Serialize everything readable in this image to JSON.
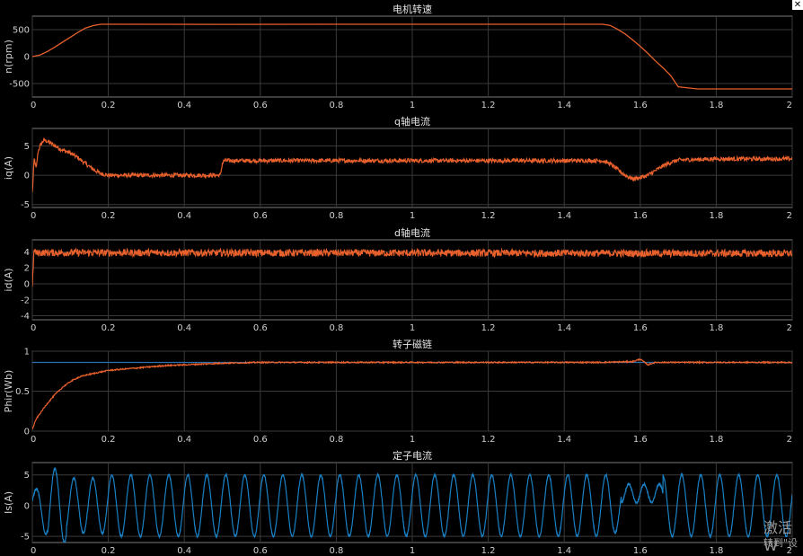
{
  "window": {
    "close_glyph": "✕"
  },
  "watermark": {
    "line1": "激活 W",
    "line2": "转到\"设"
  },
  "colors": {
    "orange": "#e8602c",
    "blue": "#1a80c4",
    "ref_blue": "#2a6fb0"
  },
  "chart_data": [
    {
      "type": "line",
      "title": "电机转速",
      "ylabel": "n(rpm)",
      "xlim": [
        0,
        2
      ],
      "ylim": [
        -750,
        750
      ],
      "xticks": [
        "0",
        "0.2",
        "0.4",
        "0.6",
        "0.8",
        "1",
        "1.2",
        "1.4",
        "1.6",
        "1.8",
        "2"
      ],
      "yticks": [
        "500",
        "0",
        "-500"
      ],
      "series": [
        {
          "color": "#e8602c",
          "x": [
            0,
            0.02,
            0.04,
            0.06,
            0.08,
            0.1,
            0.12,
            0.14,
            0.16,
            0.18,
            0.2,
            0.5,
            1.0,
            1.5,
            1.52,
            1.54,
            1.56,
            1.58,
            1.6,
            1.62,
            1.64,
            1.66,
            1.68,
            1.7,
            1.75,
            2.0
          ],
          "y": [
            0,
            30,
            95,
            180,
            270,
            360,
            450,
            530,
            575,
            600,
            600,
            598,
            600,
            600,
            580,
            510,
            420,
            310,
            190,
            60,
            -80,
            -210,
            -350,
            -560,
            -600,
            -600
          ]
        }
      ]
    },
    {
      "type": "line",
      "title": "q轴电流",
      "ylabel": "iq(A)",
      "xlim": [
        0,
        2
      ],
      "ylim": [
        -5.5,
        8
      ],
      "xticks": [
        "0",
        "0.2",
        "0.4",
        "0.6",
        "0.8",
        "1",
        "1.2",
        "1.4",
        "1.6",
        "1.8",
        "2"
      ],
      "yticks": [
        "5",
        "0",
        "-5"
      ],
      "series": [
        {
          "color": "#e8602c",
          "noise": 0.35,
          "x": [
            0,
            0.005,
            0.01,
            0.015,
            0.02,
            0.03,
            0.04,
            0.06,
            0.08,
            0.1,
            0.12,
            0.14,
            0.16,
            0.18,
            0.2,
            0.3,
            0.4,
            0.495,
            0.5,
            0.505,
            1.0,
            1.5,
            1.52,
            1.54,
            1.56,
            1.58,
            1.6,
            1.62,
            1.64,
            1.66,
            1.68,
            1.7,
            1.8,
            2.0
          ],
          "y": [
            -3,
            3,
            1,
            4,
            5,
            6,
            5.8,
            5,
            4.3,
            3.8,
            3,
            2,
            1,
            0.3,
            0,
            0,
            0,
            0,
            2,
            2.5,
            2.5,
            2.5,
            2,
            1,
            0,
            -0.6,
            -0.4,
            0,
            0.8,
            1.6,
            2.2,
            2.6,
            2.8,
            2.8
          ]
        }
      ]
    },
    {
      "type": "line",
      "title": "d轴电流",
      "ylabel": "id(A)",
      "xlim": [
        0,
        2
      ],
      "ylim": [
        -4.5,
        5.5
      ],
      "xticks": [
        "0",
        "0.2",
        "0.4",
        "0.6",
        "0.8",
        "1",
        "1.2",
        "1.4",
        "1.6",
        "1.8",
        "2"
      ],
      "yticks": [
        "4",
        "2",
        "0",
        "-2",
        "-4"
      ],
      "series": [
        {
          "color": "#e8602c",
          "noise": 0.45,
          "x": [
            0,
            0.005,
            0.01,
            0.02,
            2.0
          ],
          "y": [
            0,
            4.4,
            3.8,
            3.9,
            3.8
          ]
        }
      ]
    },
    {
      "type": "line",
      "title": "转子磁链",
      "ylabel": "Phir(Wb)",
      "xlim": [
        0,
        2
      ],
      "ylim": [
        0,
        1
      ],
      "xticks": [
        "0",
        "0.2",
        "0.4",
        "0.6",
        "0.8",
        "1",
        "1.2",
        "1.4",
        "1.6",
        "1.8",
        "2"
      ],
      "yticks": [
        "1",
        "0.5",
        "0"
      ],
      "series": [
        {
          "color": "#2a6fb0",
          "x": [
            0,
            2.0
          ],
          "y": [
            0.86,
            0.86
          ]
        },
        {
          "color": "#e8602c",
          "noise": 0.008,
          "x": [
            0,
            0.01,
            0.02,
            0.04,
            0.06,
            0.08,
            0.1,
            0.12,
            0.14,
            0.16,
            0.2,
            0.25,
            0.3,
            0.35,
            0.4,
            0.5,
            0.6,
            1.0,
            1.5,
            1.58,
            1.6,
            1.62,
            1.64,
            1.7,
            2.0
          ],
          "y": [
            0.02,
            0.15,
            0.22,
            0.35,
            0.46,
            0.55,
            0.62,
            0.67,
            0.7,
            0.72,
            0.76,
            0.78,
            0.8,
            0.82,
            0.83,
            0.85,
            0.86,
            0.86,
            0.86,
            0.87,
            0.9,
            0.83,
            0.86,
            0.86,
            0.86
          ]
        }
      ]
    },
    {
      "type": "line",
      "title": "定子电流",
      "ylabel": "Is(A)",
      "xlim": [
        0,
        2
      ],
      "ylim": [
        -6,
        7
      ],
      "xticks": [
        "0",
        "0.2",
        "0.4",
        "0.6",
        "0.8",
        "1",
        "1.2",
        "1.4",
        "1.6",
        "1.8",
        "2"
      ],
      "yticks": [
        "5",
        "0",
        "-5"
      ],
      "series": [
        {
          "color": "#1a80c4",
          "waveform": "stator_sine",
          "amplitude": 5,
          "frequency_hz": 20
        }
      ]
    }
  ]
}
